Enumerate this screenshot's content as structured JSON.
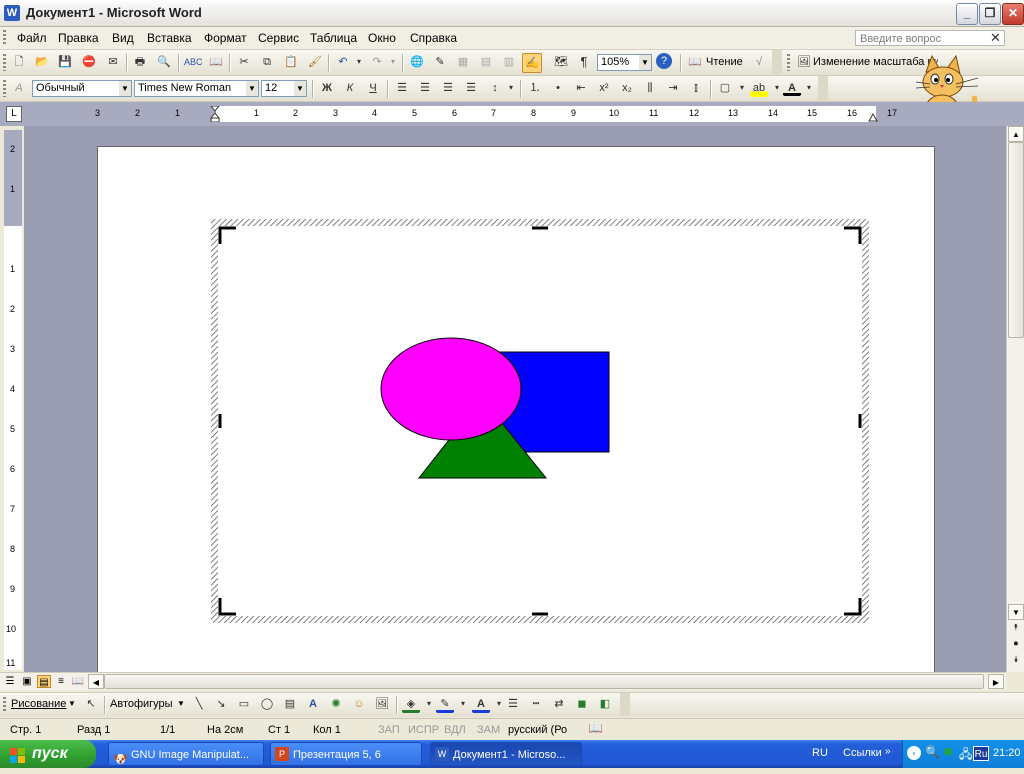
{
  "window": {
    "title": "Документ1 - Microsoft Word",
    "app_icon": "W"
  },
  "menu": [
    "Файл",
    "Правка",
    "Вид",
    "Вставка",
    "Формат",
    "Сервис",
    "Таблица",
    "Окно",
    "Справка"
  ],
  "help_box": {
    "placeholder": "Введите вопрос"
  },
  "standard_toolbar": {
    "zoom": "105%",
    "read_label": "Чтение",
    "picture_tool_label": "Изменение масштаба рисунк"
  },
  "format_toolbar": {
    "style": "Обычный",
    "font": "Times New Roman",
    "size": "12",
    "bold": "Ж",
    "italic": "К",
    "underline": "Ч"
  },
  "ruler": {
    "h_labels": [
      "3",
      "2",
      "1",
      "1",
      "2",
      "3",
      "4",
      "5",
      "6",
      "7",
      "8",
      "9",
      "10",
      "11",
      "12",
      "13",
      "14",
      "15",
      "16",
      "17"
    ],
    "v_labels": [
      "2",
      "1",
      "1",
      "2",
      "3",
      "4",
      "5",
      "6",
      "7",
      "8",
      "9",
      "10",
      "11"
    ]
  },
  "drawing_toolbar": {
    "draw_label": "Рисование",
    "autoshapes_label": "Автофигуры"
  },
  "status": {
    "page": "Стр. 1",
    "section": "Разд 1",
    "pages": "1/1",
    "at": "На 2см",
    "line": "Ст 1",
    "col": "Кол 1",
    "rec": "ЗАП",
    "trk": "ИСПР",
    "ext": "ВДЛ",
    "ovr": "ЗАМ",
    "lang": "русский (Ро"
  },
  "taskbar": {
    "start": "пуск",
    "items": [
      {
        "label": "GNU Image Manipulat..."
      },
      {
        "label": "Презентация 5, 6"
      },
      {
        "label": "Документ1 - Microso..."
      }
    ],
    "lang": "RU",
    "links": "Ссылки",
    "tray_lang": "Ru",
    "clock": "21:20"
  },
  "colors": {
    "ellipse": "#ff00ff",
    "square": "#0000ff",
    "triangle": "#008000"
  }
}
